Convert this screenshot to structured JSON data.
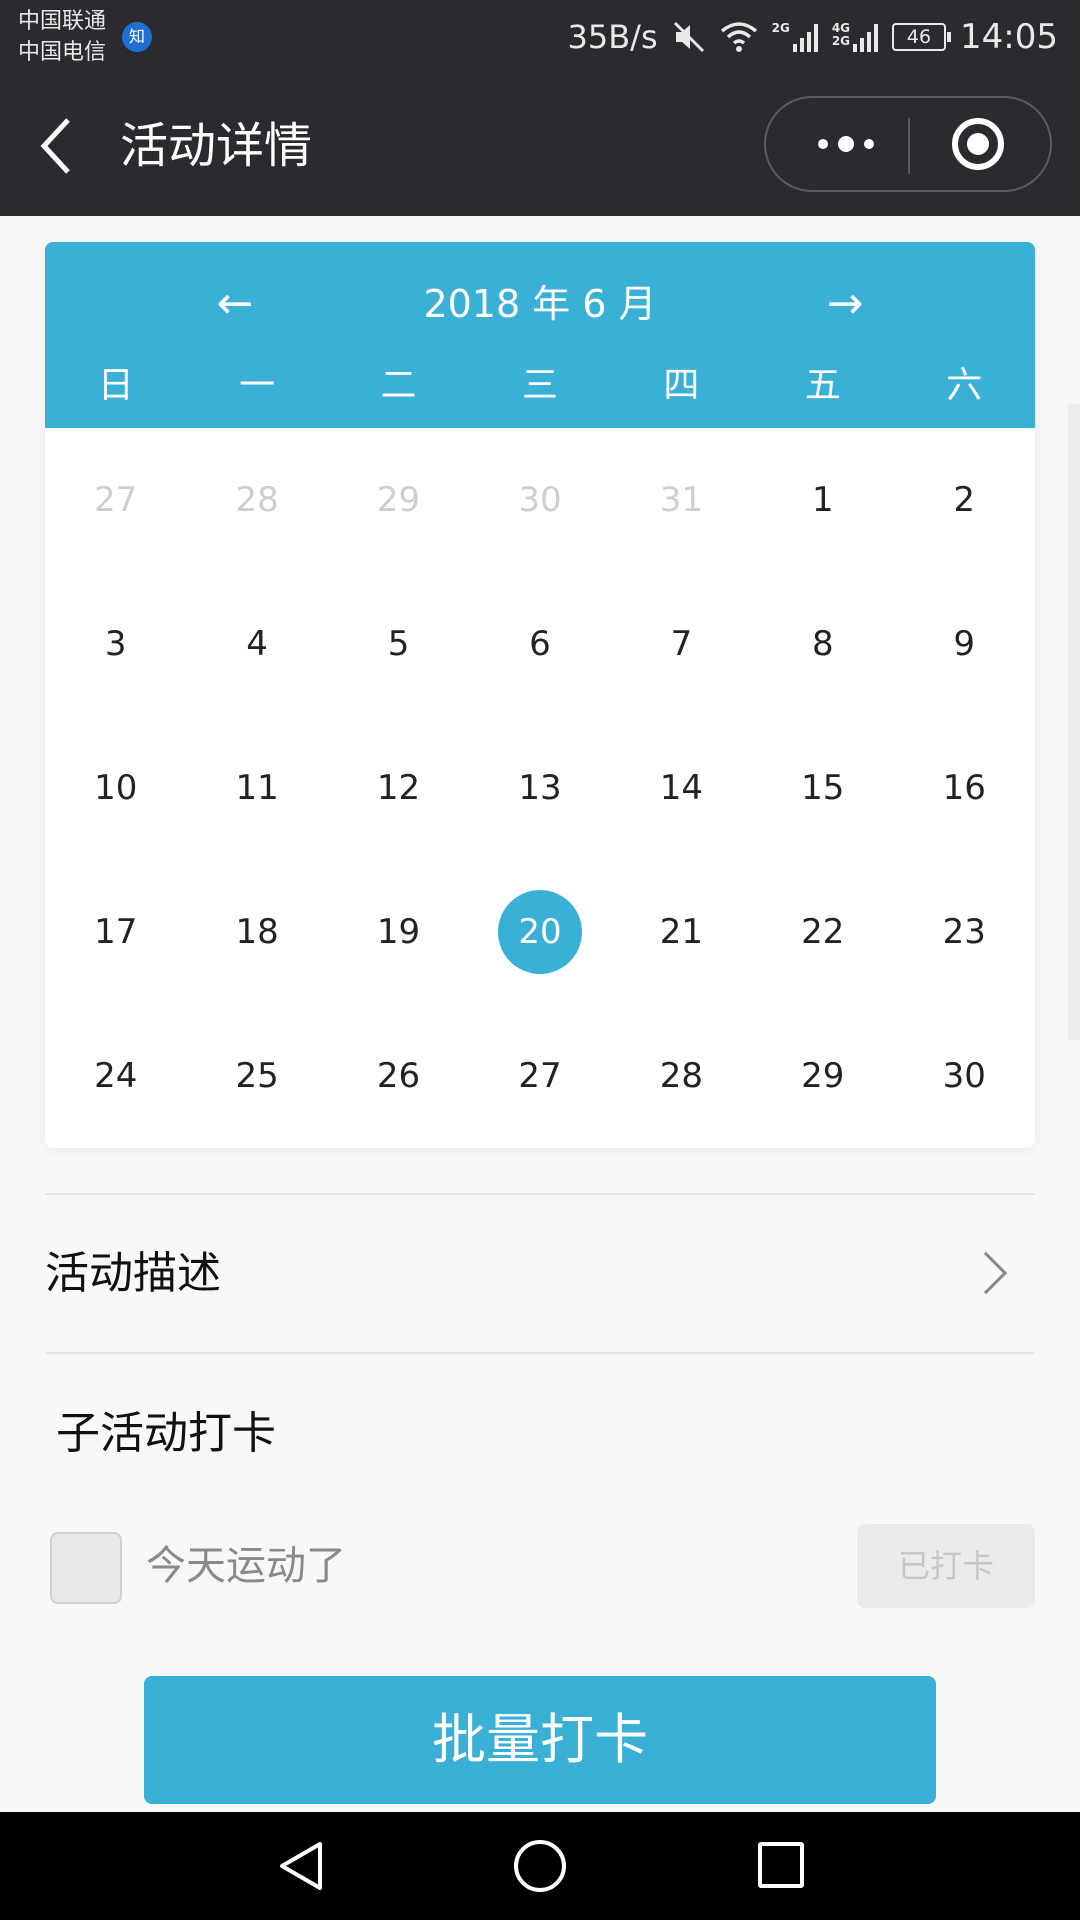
{
  "status_bar": {
    "carrier1": "中国联通",
    "carrier2": "中国电信",
    "badge": "知",
    "net_speed": "35B/s",
    "sig1_tag": "2G",
    "sig2_tag_top": "4G",
    "sig2_tag_bottom": "2G",
    "battery": "46",
    "time": "14:05"
  },
  "nav": {
    "title": "活动详情"
  },
  "calendar": {
    "prev": "←",
    "next": "→",
    "month_label": "2018 年 6 月",
    "weekdays": [
      "日",
      "一",
      "二",
      "三",
      "四",
      "五",
      "六"
    ],
    "weeks": [
      [
        "27",
        "28",
        "29",
        "30",
        "31",
        "1",
        "2"
      ],
      [
        "3",
        "4",
        "5",
        "6",
        "7",
        "8",
        "9"
      ],
      [
        "10",
        "11",
        "12",
        "13",
        "14",
        "15",
        "16"
      ],
      [
        "17",
        "18",
        "19",
        "20",
        "21",
        "22",
        "23"
      ],
      [
        "24",
        "25",
        "26",
        "27",
        "28",
        "29",
        "30"
      ]
    ],
    "selected_day": "20",
    "accent": "#3ab0d6"
  },
  "activity": {
    "description_label": "活动描述",
    "sub_title": "子活动打卡",
    "checkin_label": "今天运动了",
    "checkin_status": "已打卡",
    "batch_button": "批量打卡"
  }
}
